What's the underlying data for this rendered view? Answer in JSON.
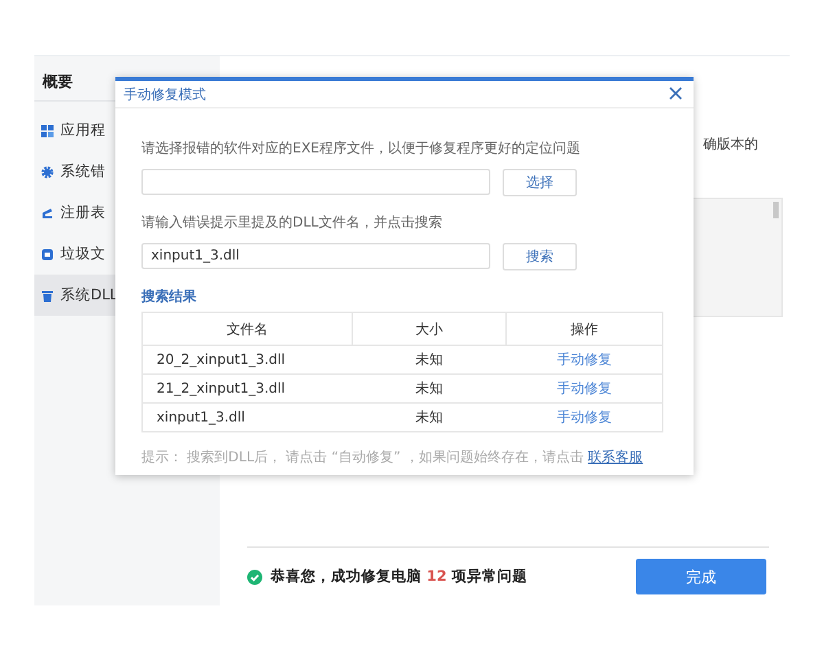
{
  "sidebar": {
    "header": "概要",
    "items": [
      {
        "label": "应用程",
        "selected": false
      },
      {
        "label": "系统错",
        "selected": false
      },
      {
        "label": "注册表",
        "selected": false
      },
      {
        "label": "垃圾文",
        "selected": false
      },
      {
        "label": "系统DLL",
        "selected": true
      }
    ]
  },
  "content": {
    "text_fragment": "确版本的"
  },
  "dialog": {
    "title": "手动修复模式",
    "exe_prompt": "请选择报错的软件对应的EXE程序文件，以便于修复程序更好的定位问题",
    "choose_button": "选择",
    "dll_prompt": "请输入错误提示里提及的DLL文件名，并点击搜索",
    "dll_field": {
      "value": "xinput1_3.dll"
    },
    "search_button": "搜索",
    "results_title": "搜索结果",
    "table": {
      "columns": [
        "文件名",
        "大小",
        "操作"
      ],
      "rows": [
        [
          "20_2_xinput1_3.dll",
          "未知",
          "手动修复"
        ],
        [
          "21_2_xinput1_3.dll",
          "未知",
          "手动修复"
        ],
        [
          "xinput1_3.dll",
          "未知",
          "手动修复"
        ]
      ]
    },
    "hint": "提示： 搜索到DLL后， 请点击 “自动修复” ，如果问题始终存在，请点击",
    "hint_link": "联系客服"
  },
  "footer": {
    "message": "恭喜您，成功修复电脑 **12** 项异常问题",
    "done_button": "完成"
  }
}
